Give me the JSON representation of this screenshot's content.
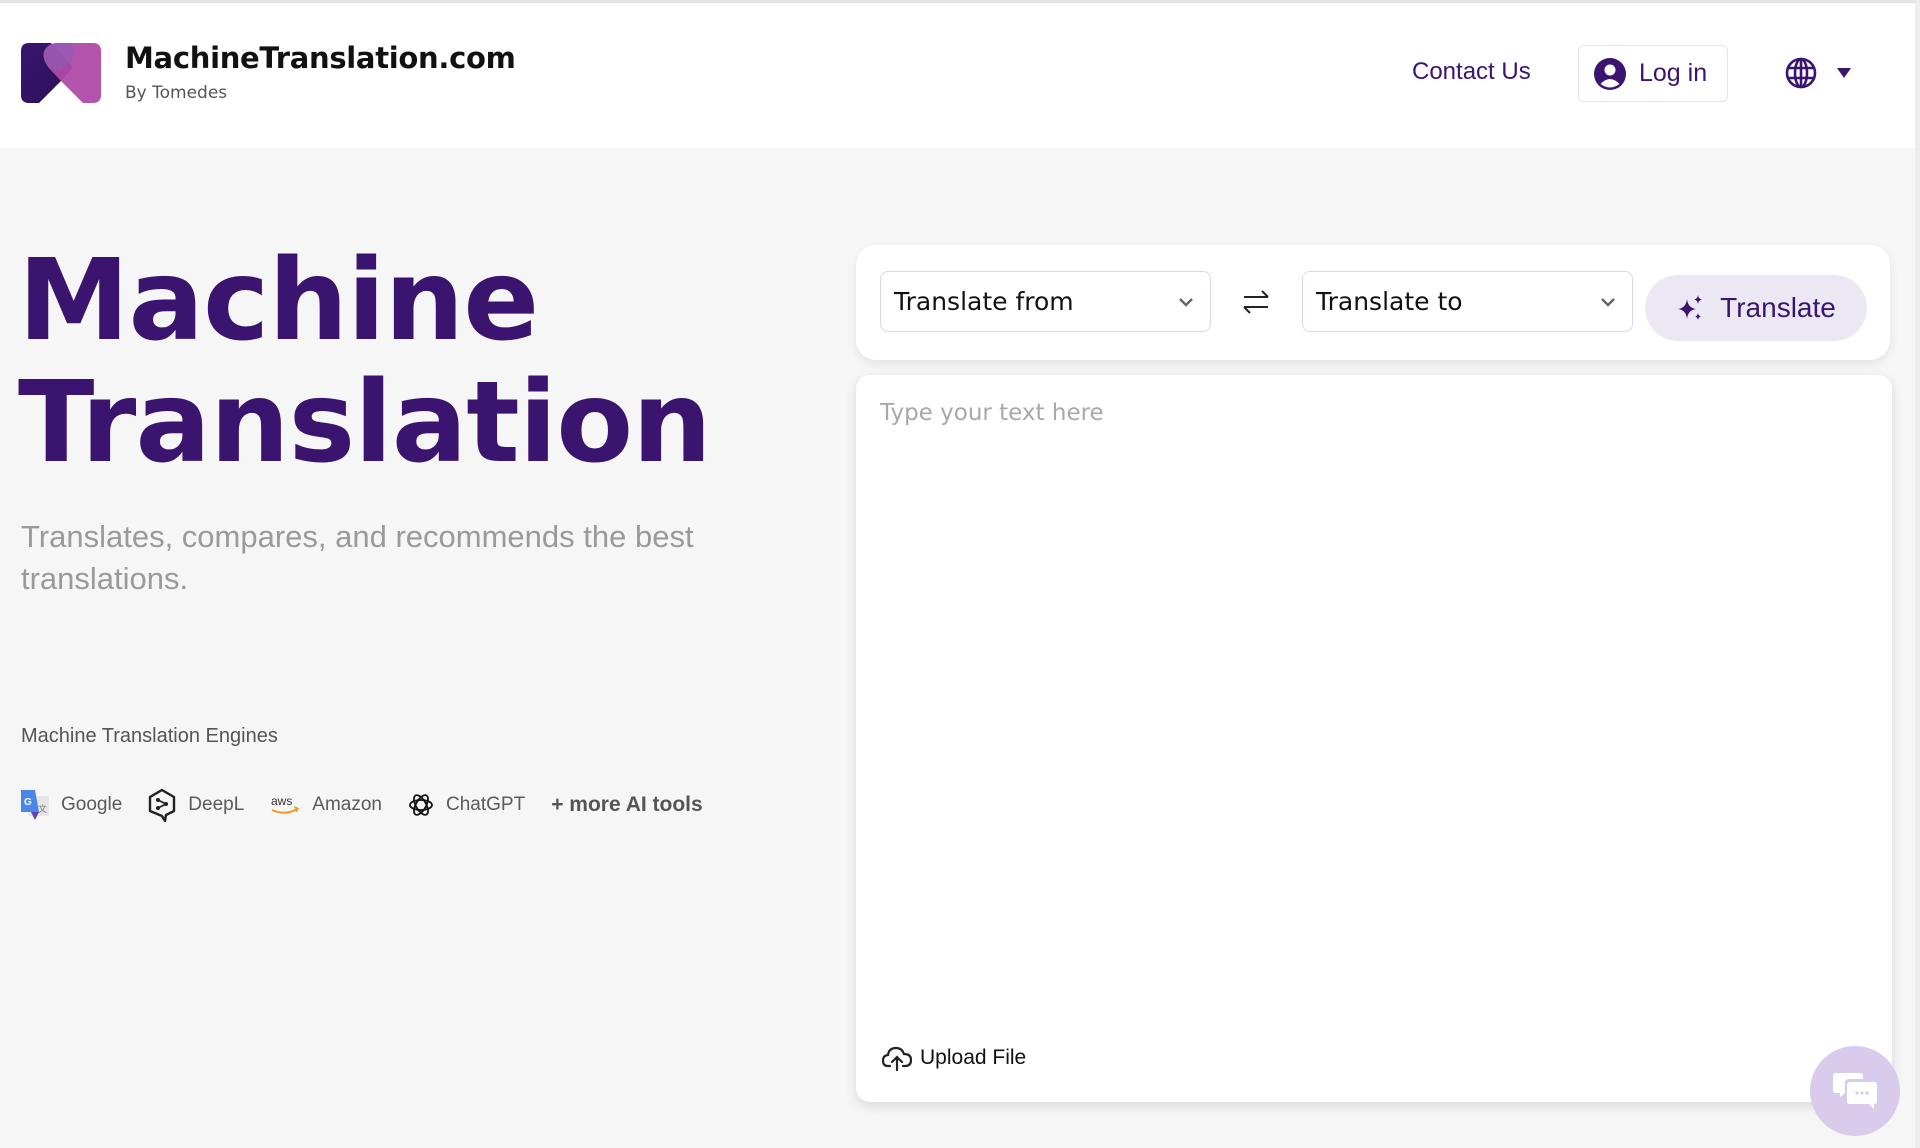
{
  "header": {
    "brand_name": "MachineTranslation.com",
    "brand_sub": "By Tomedes",
    "contact_label": "Contact Us",
    "login_label": "Log in",
    "language_icon": "globe-icon"
  },
  "hero": {
    "title_line1": "Machine",
    "title_line2": "Translation",
    "subtitle": "Translates, compares, and recommends the best translations.",
    "engines_label": "Machine Translation Engines",
    "engines": [
      {
        "name": "Google",
        "icon": "google-translate-icon"
      },
      {
        "name": "DeepL",
        "icon": "deepl-icon"
      },
      {
        "name": "Amazon",
        "icon": "aws-icon"
      },
      {
        "name": "ChatGPT",
        "icon": "openai-icon"
      }
    ],
    "more_tools": "+ more AI tools"
  },
  "translator": {
    "from_label": "Translate from",
    "to_label": "Translate to",
    "translate_label": "Translate",
    "placeholder": "Type your text here",
    "upload_label": "Upload File"
  },
  "colors": {
    "brand_purple": "#3b1470",
    "logo_magenta": "#b04aa8",
    "button_bg": "#ece8f3",
    "chat_bg": "#d8cbeb",
    "page_bg": "#f6f6f7"
  }
}
